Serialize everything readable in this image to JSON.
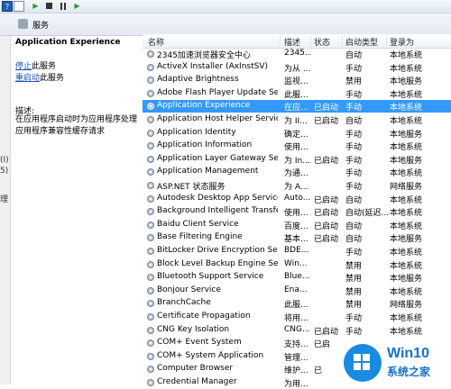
{
  "toolbar": {
    "help_icon": "?",
    "play_icon": "▶",
    "restart_icon": "▶"
  },
  "pathbar": {
    "title": "服务"
  },
  "leftpane": {
    "fragments": [
      "(I)",
      "5)",
      "理"
    ]
  },
  "detail": {
    "service_name": "Application Experience",
    "stop_link": "停止",
    "stop_suffix": "此服务",
    "restart_link": "重启动",
    "restart_suffix": "此服务",
    "desc_label": "描述:",
    "desc_text": "在应用程序启动时为应用程序处理应用程序兼容性缓存请求"
  },
  "table": {
    "columns": {
      "name": "名称",
      "desc": "描述",
      "status": "状态",
      "start": "启动类型",
      "login": "登录为"
    },
    "rows": [
      {
        "name": "2345加速浏览器安全中心",
        "desc": "2345...",
        "status": "",
        "start": "自动",
        "login": "本地系统"
      },
      {
        "name": "ActiveX Installer (AxInstSV)",
        "desc": "为从 ...",
        "status": "",
        "start": "手动",
        "login": "本地系统"
      },
      {
        "name": "Adaptive Brightness",
        "desc": "监视...",
        "status": "",
        "start": "禁用",
        "login": "本地服务"
      },
      {
        "name": "Adobe Flash Player Update Ser...",
        "desc": "此服...",
        "status": "",
        "start": "手动",
        "login": "本地系统"
      },
      {
        "name": "Application Experience",
        "desc": "在应...",
        "status": "已启动",
        "start": "手动",
        "login": "本地系统"
      },
      {
        "name": "Application Host Helper Service",
        "desc": "为 II...",
        "status": "已启动",
        "start": "自动",
        "login": "本地系统"
      },
      {
        "name": "Application Identity",
        "desc": "确定...",
        "status": "",
        "start": "手动",
        "login": "本地服务"
      },
      {
        "name": "Application Information",
        "desc": "使用...",
        "status": "",
        "start": "手动",
        "login": "本地系统"
      },
      {
        "name": "Application Layer Gateway Servi...",
        "desc": "为 In...",
        "status": "已启动",
        "start": "手动",
        "login": "本地服务"
      },
      {
        "name": "Application Management",
        "desc": "为通...",
        "status": "",
        "start": "手动",
        "login": "本地系统"
      },
      {
        "name": "ASP.NET 状态服务",
        "desc": "为 A...",
        "status": "",
        "start": "手动",
        "login": "网络服务"
      },
      {
        "name": "Autodesk Desktop App Service",
        "desc": "Auto...",
        "status": "已启动",
        "start": "自动",
        "login": "本地系统"
      },
      {
        "name": "Background Intelligent Transfer...",
        "desc": "使用...",
        "status": "已启动",
        "start": "自动(延迟...",
        "login": "本地系统"
      },
      {
        "name": "Baidu Client Service",
        "desc": "百度...",
        "status": "已启动",
        "start": "自动",
        "login": "本地系统"
      },
      {
        "name": "Base Filtering Engine",
        "desc": "基本...",
        "status": "已启动",
        "start": "自动",
        "login": "本地服务"
      },
      {
        "name": "BitLocker Drive Encryption Servi...",
        "desc": "BDE...",
        "status": "",
        "start": "手动",
        "login": "本地系统"
      },
      {
        "name": "Block Level Backup Engine Serv...",
        "desc": "Win...",
        "status": "",
        "start": "禁用",
        "login": "本地系统"
      },
      {
        "name": "Bluetooth Support Service",
        "desc": "Blue...",
        "status": "",
        "start": "禁用",
        "login": "本地服务"
      },
      {
        "name": "Bonjour Service",
        "desc": "Ena...",
        "status": "",
        "start": "禁用",
        "login": "本地系统"
      },
      {
        "name": "BranchCache",
        "desc": "此服...",
        "status": "",
        "start": "禁用",
        "login": "网络服务"
      },
      {
        "name": "Certificate Propagation",
        "desc": "将用...",
        "status": "",
        "start": "手动",
        "login": "本地系统"
      },
      {
        "name": "CNG Key Isolation",
        "desc": "CNG...",
        "status": "已启动",
        "start": "手动",
        "login": "本地系统"
      },
      {
        "name": "COM+ Event System",
        "desc": "支持...",
        "status": "已启",
        "start": "",
        "login": ""
      },
      {
        "name": "COM+ System Application",
        "desc": "管理...",
        "status": "",
        "start": "",
        "login": ""
      },
      {
        "name": "Computer Browser",
        "desc": "维护...",
        "status": "已",
        "start": "",
        "login": ""
      },
      {
        "name": "Credential Manager",
        "desc": "为用...",
        "status": "",
        "start": "",
        "login": ""
      }
    ]
  },
  "logo": {
    "brand": "Win10",
    "subtitle": "系统之家"
  },
  "colors": {
    "selection": "#3399ff",
    "link": "#1a4fb3",
    "brand": "#1a8be0"
  }
}
